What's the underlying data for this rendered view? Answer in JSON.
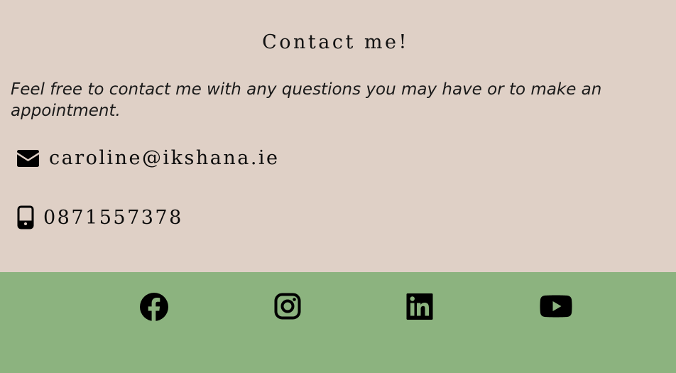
{
  "contact": {
    "title": "Contact me!",
    "intro": "Feel free to contact me with any questions you may have or to make an appointment.",
    "email": "caroline@ikshana.ie",
    "phone": "0871557378",
    "icons": {
      "email": "envelope-icon",
      "phone": "mobile-phone-icon"
    }
  },
  "footer": {
    "social": [
      {
        "name": "facebook",
        "icon": "facebook-icon"
      },
      {
        "name": "instagram",
        "icon": "instagram-icon"
      },
      {
        "name": "linkedin",
        "icon": "linkedin-icon"
      },
      {
        "name": "youtube",
        "icon": "youtube-icon"
      }
    ]
  },
  "colors": {
    "contact_background": "#dfd0c6",
    "footer_background": "#8cb37f",
    "text": "#111111"
  }
}
